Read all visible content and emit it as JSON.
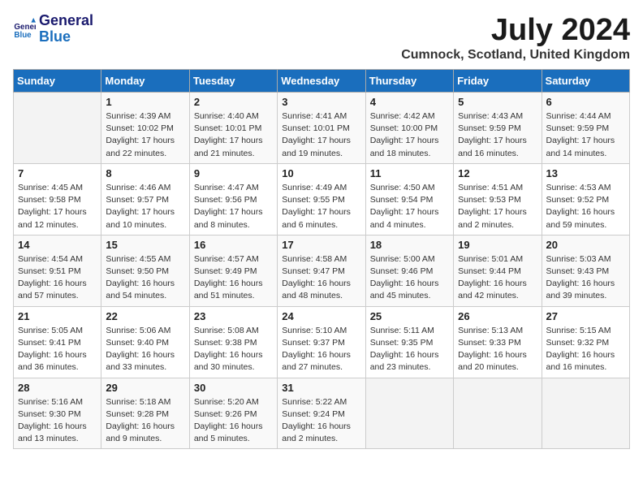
{
  "header": {
    "logo_line1": "General",
    "logo_line2": "Blue",
    "month_year": "July 2024",
    "location": "Cumnock, Scotland, United Kingdom"
  },
  "days_of_week": [
    "Sunday",
    "Monday",
    "Tuesday",
    "Wednesday",
    "Thursday",
    "Friday",
    "Saturday"
  ],
  "weeks": [
    [
      {
        "day": "",
        "info": ""
      },
      {
        "day": "1",
        "info": "Sunrise: 4:39 AM\nSunset: 10:02 PM\nDaylight: 17 hours\nand 22 minutes."
      },
      {
        "day": "2",
        "info": "Sunrise: 4:40 AM\nSunset: 10:01 PM\nDaylight: 17 hours\nand 21 minutes."
      },
      {
        "day": "3",
        "info": "Sunrise: 4:41 AM\nSunset: 10:01 PM\nDaylight: 17 hours\nand 19 minutes."
      },
      {
        "day": "4",
        "info": "Sunrise: 4:42 AM\nSunset: 10:00 PM\nDaylight: 17 hours\nand 18 minutes."
      },
      {
        "day": "5",
        "info": "Sunrise: 4:43 AM\nSunset: 9:59 PM\nDaylight: 17 hours\nand 16 minutes."
      },
      {
        "day": "6",
        "info": "Sunrise: 4:44 AM\nSunset: 9:59 PM\nDaylight: 17 hours\nand 14 minutes."
      }
    ],
    [
      {
        "day": "7",
        "info": "Sunrise: 4:45 AM\nSunset: 9:58 PM\nDaylight: 17 hours\nand 12 minutes."
      },
      {
        "day": "8",
        "info": "Sunrise: 4:46 AM\nSunset: 9:57 PM\nDaylight: 17 hours\nand 10 minutes."
      },
      {
        "day": "9",
        "info": "Sunrise: 4:47 AM\nSunset: 9:56 PM\nDaylight: 17 hours\nand 8 minutes."
      },
      {
        "day": "10",
        "info": "Sunrise: 4:49 AM\nSunset: 9:55 PM\nDaylight: 17 hours\nand 6 minutes."
      },
      {
        "day": "11",
        "info": "Sunrise: 4:50 AM\nSunset: 9:54 PM\nDaylight: 17 hours\nand 4 minutes."
      },
      {
        "day": "12",
        "info": "Sunrise: 4:51 AM\nSunset: 9:53 PM\nDaylight: 17 hours\nand 2 minutes."
      },
      {
        "day": "13",
        "info": "Sunrise: 4:53 AM\nSunset: 9:52 PM\nDaylight: 16 hours\nand 59 minutes."
      }
    ],
    [
      {
        "day": "14",
        "info": "Sunrise: 4:54 AM\nSunset: 9:51 PM\nDaylight: 16 hours\nand 57 minutes."
      },
      {
        "day": "15",
        "info": "Sunrise: 4:55 AM\nSunset: 9:50 PM\nDaylight: 16 hours\nand 54 minutes."
      },
      {
        "day": "16",
        "info": "Sunrise: 4:57 AM\nSunset: 9:49 PM\nDaylight: 16 hours\nand 51 minutes."
      },
      {
        "day": "17",
        "info": "Sunrise: 4:58 AM\nSunset: 9:47 PM\nDaylight: 16 hours\nand 48 minutes."
      },
      {
        "day": "18",
        "info": "Sunrise: 5:00 AM\nSunset: 9:46 PM\nDaylight: 16 hours\nand 45 minutes."
      },
      {
        "day": "19",
        "info": "Sunrise: 5:01 AM\nSunset: 9:44 PM\nDaylight: 16 hours\nand 42 minutes."
      },
      {
        "day": "20",
        "info": "Sunrise: 5:03 AM\nSunset: 9:43 PM\nDaylight: 16 hours\nand 39 minutes."
      }
    ],
    [
      {
        "day": "21",
        "info": "Sunrise: 5:05 AM\nSunset: 9:41 PM\nDaylight: 16 hours\nand 36 minutes."
      },
      {
        "day": "22",
        "info": "Sunrise: 5:06 AM\nSunset: 9:40 PM\nDaylight: 16 hours\nand 33 minutes."
      },
      {
        "day": "23",
        "info": "Sunrise: 5:08 AM\nSunset: 9:38 PM\nDaylight: 16 hours\nand 30 minutes."
      },
      {
        "day": "24",
        "info": "Sunrise: 5:10 AM\nSunset: 9:37 PM\nDaylight: 16 hours\nand 27 minutes."
      },
      {
        "day": "25",
        "info": "Sunrise: 5:11 AM\nSunset: 9:35 PM\nDaylight: 16 hours\nand 23 minutes."
      },
      {
        "day": "26",
        "info": "Sunrise: 5:13 AM\nSunset: 9:33 PM\nDaylight: 16 hours\nand 20 minutes."
      },
      {
        "day": "27",
        "info": "Sunrise: 5:15 AM\nSunset: 9:32 PM\nDaylight: 16 hours\nand 16 minutes."
      }
    ],
    [
      {
        "day": "28",
        "info": "Sunrise: 5:16 AM\nSunset: 9:30 PM\nDaylight: 16 hours\nand 13 minutes."
      },
      {
        "day": "29",
        "info": "Sunrise: 5:18 AM\nSunset: 9:28 PM\nDaylight: 16 hours\nand 9 minutes."
      },
      {
        "day": "30",
        "info": "Sunrise: 5:20 AM\nSunset: 9:26 PM\nDaylight: 16 hours\nand 5 minutes."
      },
      {
        "day": "31",
        "info": "Sunrise: 5:22 AM\nSunset: 9:24 PM\nDaylight: 16 hours\nand 2 minutes."
      },
      {
        "day": "",
        "info": ""
      },
      {
        "day": "",
        "info": ""
      },
      {
        "day": "",
        "info": ""
      }
    ]
  ]
}
